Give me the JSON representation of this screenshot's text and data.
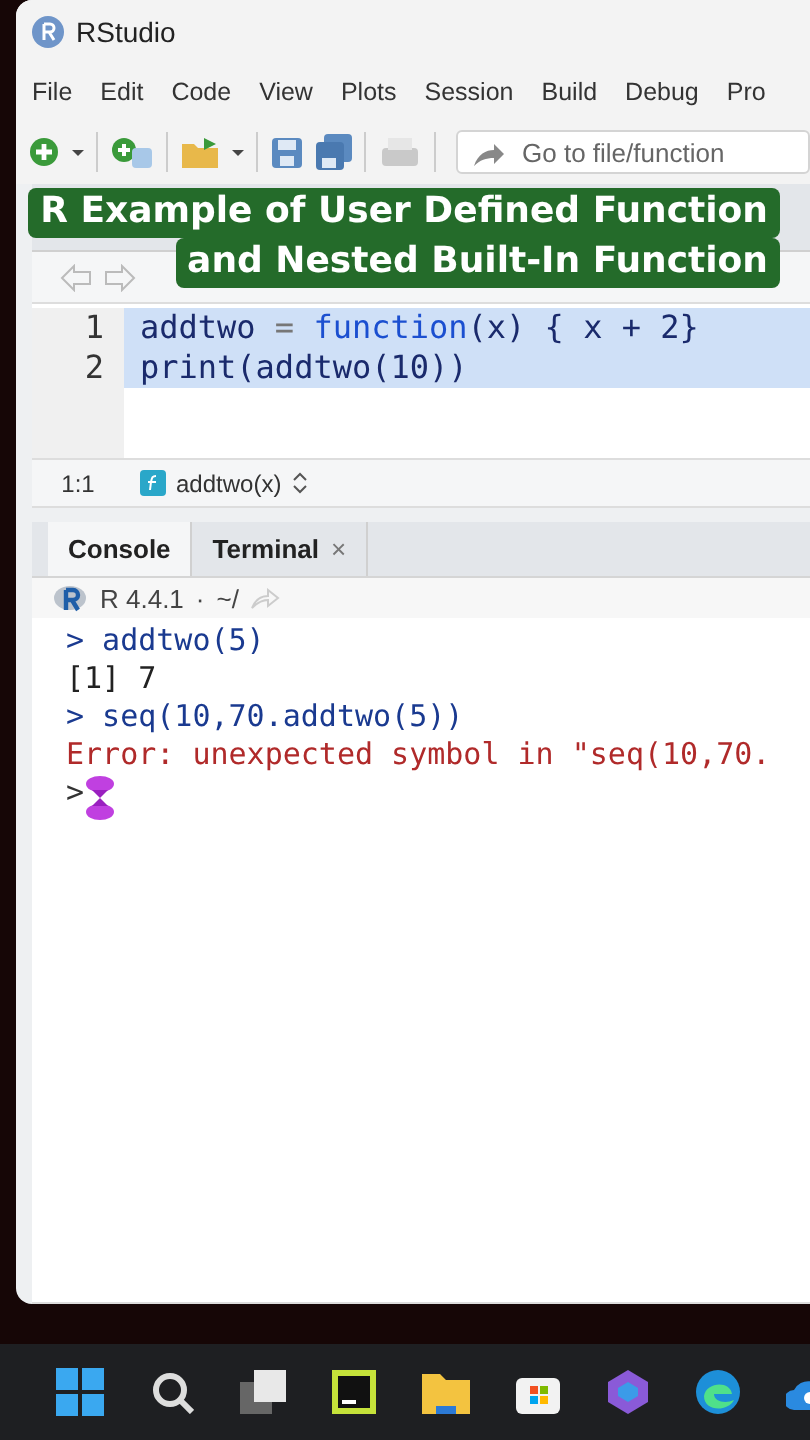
{
  "window": {
    "title": "RStudio"
  },
  "menu": [
    "File",
    "Edit",
    "Code",
    "View",
    "Plots",
    "Session",
    "Build",
    "Debug",
    "Pro"
  ],
  "goto": {
    "placeholder": "Go to file/function"
  },
  "banner": {
    "lines": [
      "R Example of User Defined Function",
      "and Nested Built-In Function"
    ]
  },
  "editor": {
    "lines": [
      {
        "number": "1",
        "selected": true,
        "tokens": [
          {
            "text": "addtwo",
            "kind": "name"
          },
          {
            "text": " = ",
            "kind": "op"
          },
          {
            "text": "function",
            "kind": "keyword"
          },
          {
            "text": "(x) { x + 2}",
            "kind": "name"
          }
        ]
      },
      {
        "number": "2",
        "selected": true,
        "tokens": [
          {
            "text": "print(addtwo(10))",
            "kind": "name"
          }
        ]
      }
    ],
    "status": {
      "position": "1:1",
      "scope": "addtwo(x)"
    }
  },
  "console": {
    "tabs": [
      {
        "label": "Console",
        "selected": true
      },
      {
        "label": "Terminal",
        "selected": false,
        "close": "×"
      }
    ],
    "version": "R 4.4.1",
    "separator": "·",
    "path": "~/",
    "lines": [
      {
        "kind": "input",
        "prompt": ">",
        "text": "addtwo(5)"
      },
      {
        "kind": "output",
        "text": "[1] 7"
      },
      {
        "kind": "input",
        "prompt": ">",
        "text": "seq(10,70.addtwo(5))"
      },
      {
        "kind": "error",
        "text": "Error: unexpected symbol in \"seq(10,70."
      },
      {
        "kind": "busy",
        "prompt": ">"
      }
    ]
  }
}
